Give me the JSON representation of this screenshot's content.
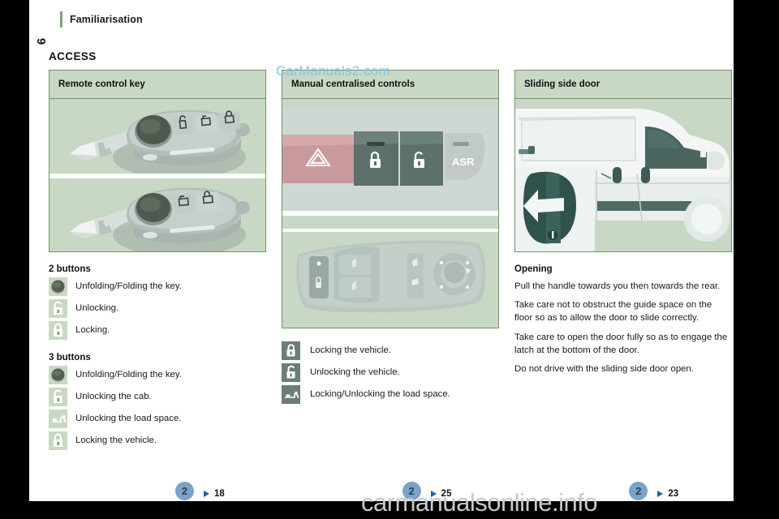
{
  "document": {
    "chapter": "Familiarisation",
    "page_number": "6",
    "section_title": "ACCESS"
  },
  "watermarks": {
    "top": "CarManuals2.com",
    "bottom": "carmanualsonline.info"
  },
  "columns": [
    {
      "panel_title": "Remote control key",
      "figure": "remote-control-keys",
      "groups": [
        {
          "heading": "2 buttons",
          "items": [
            {
              "icon": "round-button-icon",
              "label": "Unfolding/Folding the key."
            },
            {
              "icon": "unlock-icon",
              "label": "Unlocking."
            },
            {
              "icon": "lock-icon",
              "label": "Locking."
            }
          ]
        },
        {
          "heading": "3 buttons",
          "items": [
            {
              "icon": "round-button-icon",
              "label": "Unfolding/Folding the key."
            },
            {
              "icon": "unlock-cab-icon",
              "label": "Unlocking the cab."
            },
            {
              "icon": "load-space-icon",
              "label": "Unlocking the load space."
            },
            {
              "icon": "lock-icon",
              "label": "Locking the vehicle."
            }
          ]
        }
      ],
      "footer": {
        "badge": "2",
        "page_ref": "18"
      }
    },
    {
      "panel_title": "Manual centralised controls",
      "figure": "dashboard-lock-controls",
      "items": [
        {
          "icon": "lock-icon",
          "label": "Locking the vehicle."
        },
        {
          "icon": "unlock-icon",
          "label": "Unlocking the vehicle."
        },
        {
          "icon": "load-space-icon",
          "label": "Locking/Unlocking the load space."
        }
      ],
      "footer": {
        "badge": "2",
        "page_ref": "25"
      }
    },
    {
      "panel_title": "Sliding side door",
      "figure": "van-sliding-side-door",
      "heading": "Opening",
      "paragraphs": [
        "Pull the handle towards you then towards the rear.",
        "Take care not to obstruct the guide space on the floor so as to allow the door to slide correctly.",
        "Take care to open the door fully so as to engage the latch at the bottom of the door.",
        "Do not drive with the sliding side door open."
      ],
      "footer": {
        "badge": "2",
        "page_ref": "23"
      }
    }
  ],
  "colors": {
    "panel_border": "#6f9469",
    "panel_background": "#c9d8c4",
    "badge": "#7ba3c9",
    "triangle": "#1f5fa9",
    "watermark_top": "#7ec8ef",
    "watermark_bottom": "#c9c9c9"
  },
  "figure_labels": {
    "dash_asr": "ASR"
  }
}
